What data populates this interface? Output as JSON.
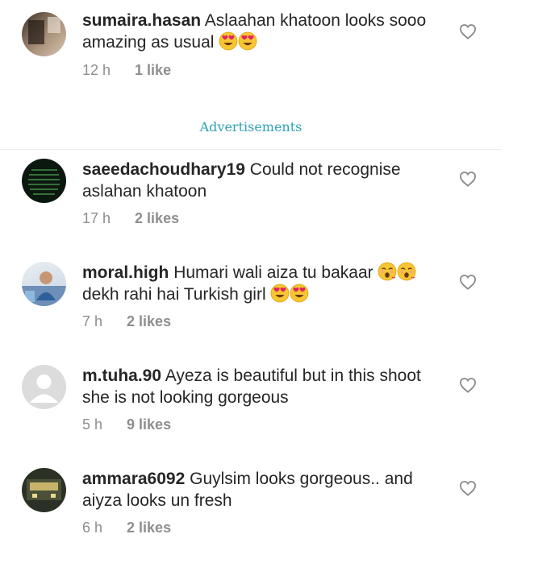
{
  "advert_label": "Advertisements",
  "icons": {
    "like": "heart-outline-icon",
    "emoji_love": "heart-eyes-emoji",
    "emoji_kiss": "kissing-emoji"
  },
  "comments": [
    {
      "username": "sumaira.hasan",
      "text": "Aslaahan khatoon looks sooo amazing as usual",
      "emojis_after": [
        "heart-eyes",
        "heart-eyes"
      ],
      "time": "12 h",
      "likes": "1 like"
    },
    {
      "username": "saeedachoudhary19",
      "text": "Could not recognise aslahan khatoon",
      "time": "17 h",
      "likes": "2 likes"
    },
    {
      "username": "moral.high",
      "text_part1": "Humari wali aiza tu bakaar",
      "text_part2": "dekh rahi hai Turkish girl",
      "time": "7 h",
      "likes": "2 likes"
    },
    {
      "username": "m.tuha.90",
      "text": "Ayeza is beautiful but in this shoot she is not looking gorgeous",
      "time": "5 h",
      "likes": "9 likes"
    },
    {
      "username": "ammara6092",
      "text": "Guylsim looks gorgeous.. and aiyza looks un fresh",
      "time": "6 h",
      "likes": "2 likes"
    }
  ]
}
